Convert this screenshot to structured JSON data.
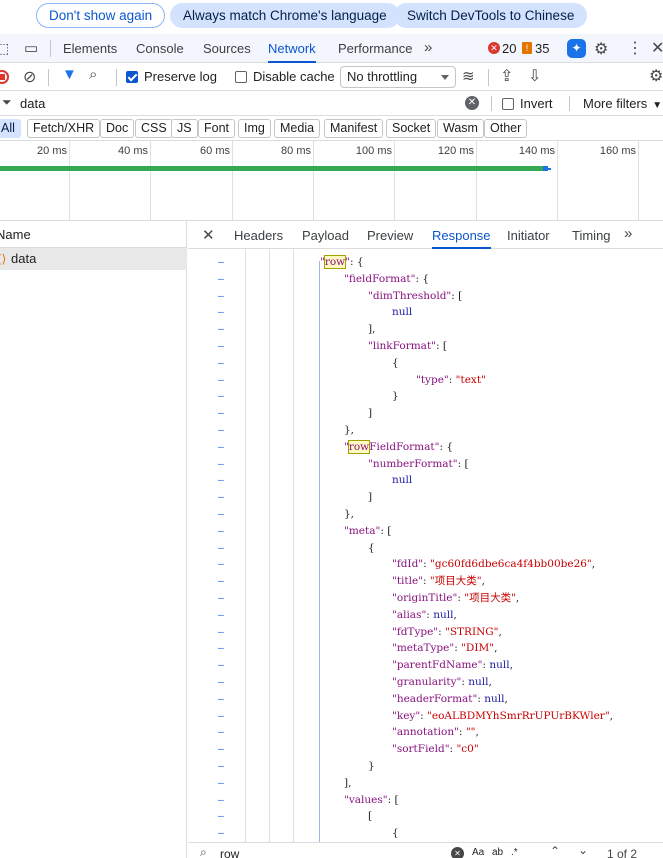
{
  "infobar": {
    "dont_show": "Don't show again",
    "always_match": "Always match Chrome's language",
    "switch_devtools": "Switch DevTools to Chinese"
  },
  "main_tabs": [
    "Elements",
    "Console",
    "Sources",
    "Network",
    "Performance"
  ],
  "active_main_tab": "Network",
  "counters": {
    "errors": "20",
    "warnings": "35"
  },
  "toolbar": {
    "preserve_log": "Preserve log",
    "preserve_log_checked": true,
    "disable_cache": "Disable cache",
    "disable_cache_checked": false,
    "throttling": "No throttling"
  },
  "filter": {
    "value": "data",
    "invert": "Invert",
    "more_filters": "More filters"
  },
  "type_filters": [
    "All",
    "Fetch/XHR",
    "Doc",
    "CSS",
    "JS",
    "Font",
    "Img",
    "Media",
    "Manifest",
    "Socket",
    "Wasm",
    "Other"
  ],
  "active_type_filter": "All",
  "overview": {
    "ticks": [
      "20 ms",
      "40 ms",
      "60 ms",
      "80 ms",
      "100 ms",
      "120 ms",
      "140 ms",
      "160 ms"
    ]
  },
  "requests": {
    "column_header": "Name",
    "items": [
      "data"
    ]
  },
  "detail_tabs": [
    "Headers",
    "Payload",
    "Preview",
    "Response",
    "Initiator",
    "Timing"
  ],
  "active_detail_tab": "Response",
  "response_lines": [
    [
      "row_open",
      ""
    ],
    [
      "key_obj",
      "fieldFormat"
    ],
    [
      "key_arr",
      "dimThreshold"
    ],
    [
      "null",
      ""
    ],
    [
      "close_arr_comma",
      ""
    ],
    [
      "key_arr",
      "linkFormat"
    ],
    [
      "open_obj",
      ""
    ],
    [
      "kv_str",
      "type",
      "text"
    ],
    [
      "close_obj",
      ""
    ],
    [
      "close_arr",
      ""
    ],
    [
      "close_obj_comma",
      ""
    ],
    [
      "key_obj_hl",
      "rowFieldFormat"
    ],
    [
      "key_arr",
      "numberFormat"
    ],
    [
      "null",
      ""
    ],
    [
      "close_arr",
      ""
    ],
    [
      "close_obj_comma",
      ""
    ],
    [
      "key_arr",
      "meta"
    ],
    [
      "open_obj",
      ""
    ],
    [
      "kv",
      "fdId",
      "\"gc60fd6dbe6ca4f4bb00be26\","
    ],
    [
      "kv",
      "title",
      "\"项目大类\","
    ],
    [
      "kv",
      "originTitle",
      "\"项目大类\","
    ],
    [
      "kv",
      "alias",
      "null,"
    ],
    [
      "kv",
      "fdType",
      "\"STRING\","
    ],
    [
      "kv",
      "metaType",
      "\"DIM\","
    ],
    [
      "kv",
      "parentFdName",
      "null,"
    ],
    [
      "kv",
      "granularity",
      "null,"
    ],
    [
      "kv",
      "headerFormat",
      "null,"
    ],
    [
      "kv",
      "key",
      "\"eoALBDMYhSmrRrUPUrBKWler\","
    ],
    [
      "kv",
      "annotation",
      "\"\","
    ],
    [
      "kv",
      "sortField",
      "\"c0\""
    ],
    [
      "close_obj",
      ""
    ],
    [
      "close_arr_comma",
      ""
    ],
    [
      "key_arr",
      "values"
    ],
    [
      "open_arr",
      ""
    ],
    [
      "open_obj",
      ""
    ]
  ],
  "search": {
    "value": "row",
    "match_case": "Aa",
    "regex": ".*",
    "count": "1 of 2"
  }
}
